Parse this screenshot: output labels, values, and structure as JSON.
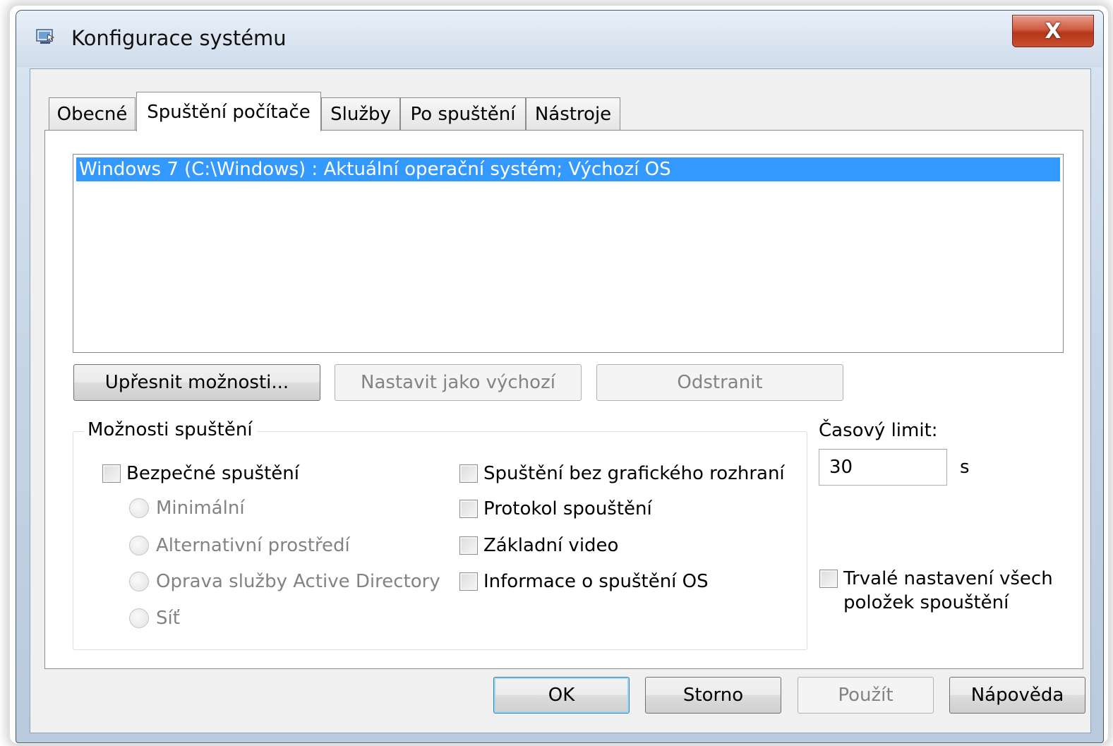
{
  "window": {
    "title": "Konfigurace systému",
    "close_symbol": "X"
  },
  "tabs": [
    {
      "label": "Obecné",
      "active": false
    },
    {
      "label": "Spuštění počítače",
      "active": true
    },
    {
      "label": "Služby",
      "active": false
    },
    {
      "label": "Po spuštění",
      "active": false
    },
    {
      "label": "Nástroje",
      "active": false
    }
  ],
  "boot_list": {
    "items": [
      "Windows 7 (C:\\Windows) : Aktuální operační systém; Výchozí OS"
    ]
  },
  "boot_buttons": {
    "advanced": "Upřesnit možnosti...",
    "set_default": "Nastavit jako výchozí",
    "delete": "Odstranit"
  },
  "boot_options": {
    "title": "Možnosti spuštění",
    "safe_boot": "Bezpečné spuštění",
    "radios": [
      "Minimální",
      "Alternativní prostředí",
      "Oprava služby Active Directory",
      "Síť"
    ],
    "no_gui": "Spuštění bez grafického rozhraní",
    "boot_log": "Protokol spouštění",
    "base_video": "Základní video",
    "os_boot_info": "Informace o spuštění OS"
  },
  "timeout": {
    "label": "Časový limit:",
    "value": "30",
    "unit": "s"
  },
  "permanent": {
    "line1": "Trvalé nastavení všech",
    "line2": "položek spouštění"
  },
  "dialog_buttons": {
    "ok": "OK",
    "cancel": "Storno",
    "apply": "Použít",
    "help": "Nápověda"
  },
  "colors": {
    "selection": "#3399ff",
    "close_button": "#c9502e"
  }
}
